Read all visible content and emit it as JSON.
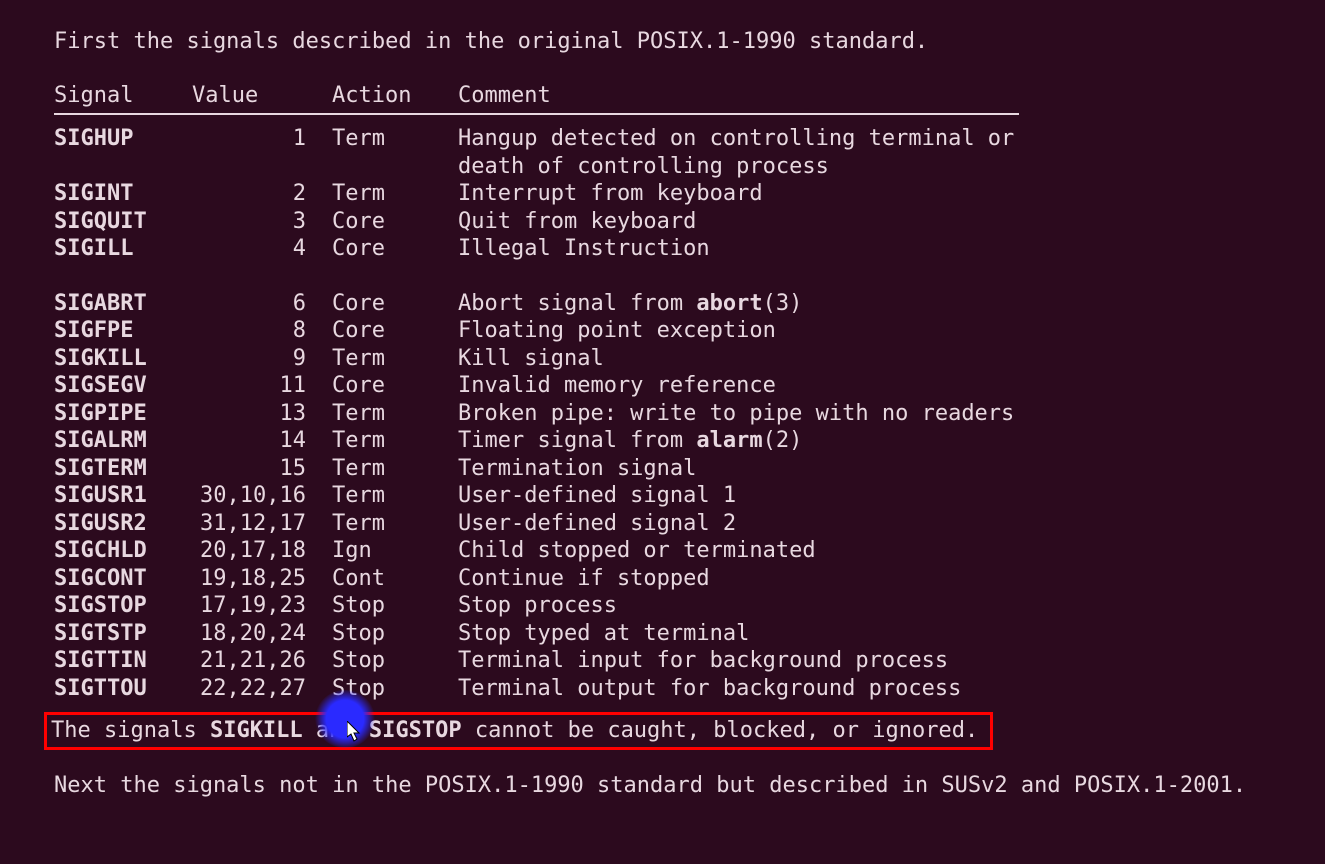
{
  "intro": "First the signals described in the original POSIX.1-1990 standard.",
  "headers": {
    "signal": "Signal",
    "value": "Value",
    "action": "Action",
    "comment": "Comment"
  },
  "signals": [
    {
      "name": "SIGHUP",
      "value": "1",
      "action": "Term",
      "comment": "Hangup detected on controlling terminal or death of controlling process"
    },
    {
      "name": "SIGINT",
      "value": "2",
      "action": "Term",
      "comment": "Interrupt from keyboard"
    },
    {
      "name": "SIGQUIT",
      "value": "3",
      "action": "Core",
      "comment": "Quit from keyboard"
    },
    {
      "name": "SIGILL",
      "value": "4",
      "action": "Core",
      "comment": "Illegal Instruction"
    },
    {
      "name": "",
      "value": "",
      "action": "",
      "comment": ""
    },
    {
      "name": "SIGABRT",
      "value": "6",
      "action": "Core",
      "comment": "Abort signal from ",
      "bref": "abort",
      "bnum": "(3)"
    },
    {
      "name": "SIGFPE",
      "value": "8",
      "action": "Core",
      "comment": "Floating point exception"
    },
    {
      "name": "SIGKILL",
      "value": "9",
      "action": "Term",
      "comment": "Kill signal"
    },
    {
      "name": "SIGSEGV",
      "value": "11",
      "action": "Core",
      "comment": "Invalid memory reference"
    },
    {
      "name": "SIGPIPE",
      "value": "13",
      "action": "Term",
      "comment": "Broken pipe: write to pipe with no readers"
    },
    {
      "name": "SIGALRM",
      "value": "14",
      "action": "Term",
      "comment": "Timer signal from ",
      "bref": "alarm",
      "bnum": "(2)"
    },
    {
      "name": "SIGTERM",
      "value": "15",
      "action": "Term",
      "comment": "Termination signal"
    },
    {
      "name": "SIGUSR1",
      "value": "30,10,16",
      "action": "Term",
      "comment": "User-defined signal 1"
    },
    {
      "name": "SIGUSR2",
      "value": "31,12,17",
      "action": "Term",
      "comment": "User-defined signal 2"
    },
    {
      "name": "SIGCHLD",
      "value": "20,17,18",
      "action": "Ign",
      "comment": "Child stopped or terminated"
    },
    {
      "name": "SIGCONT",
      "value": "19,18,25",
      "action": "Cont",
      "comment": "Continue if stopped"
    },
    {
      "name": "SIGSTOP",
      "value": "17,19,23",
      "action": "Stop",
      "comment": "Stop process"
    },
    {
      "name": "SIGTSTP",
      "value": "18,20,24",
      "action": "Stop",
      "comment": "Stop typed at terminal"
    },
    {
      "name": "SIGTTIN",
      "value": "21,21,26",
      "action": "Stop",
      "comment": "Terminal input for background process"
    },
    {
      "name": "SIGTTOU",
      "value": "22,22,27",
      "action": "Stop",
      "comment": "Terminal output for background process"
    }
  ],
  "note": {
    "pre": "The signals ",
    "b1": "SIGKILL",
    "mid": " and ",
    "b2": "SIGSTOP",
    "post": " cannot be caught, blocked, or ignored."
  },
  "next": "Next the signals not in the POSIX.1-1990 standard but described in SUSv2 and POSIX.1-2001."
}
